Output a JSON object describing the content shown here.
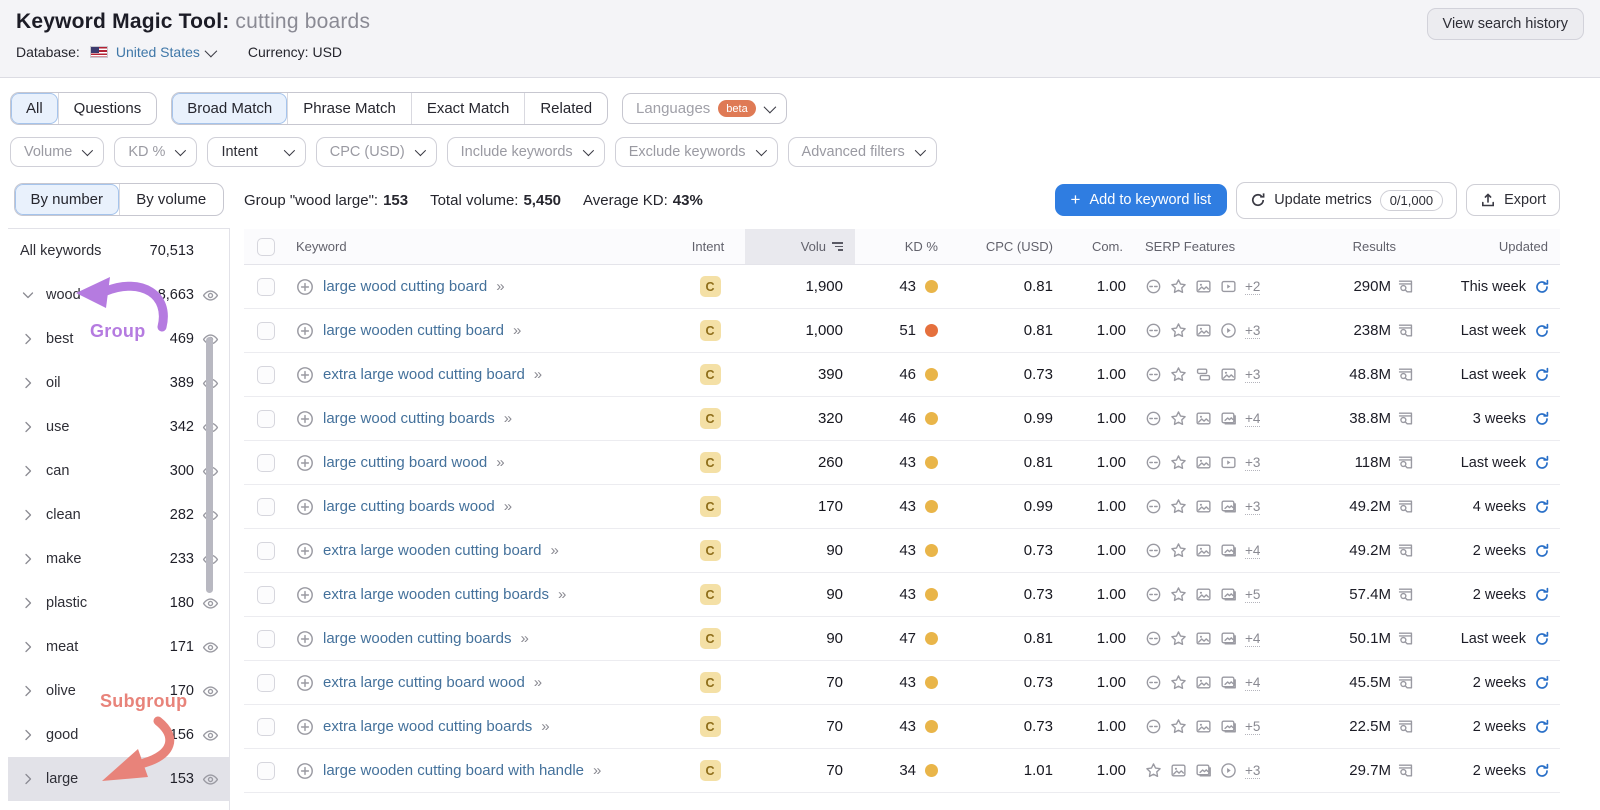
{
  "header": {
    "title": "Keyword Magic Tool:",
    "query": "cutting boards",
    "view_search_history": "View search history",
    "database_label": "Database:",
    "database_value": "United States",
    "currency_label": "Currency:",
    "currency_value": "USD"
  },
  "match_tabs": {
    "group1": [
      {
        "label": "All",
        "active": true
      },
      {
        "label": "Questions",
        "active": false
      }
    ],
    "group2": [
      {
        "label": "Broad Match",
        "active": true
      },
      {
        "label": "Phrase Match",
        "active": false
      },
      {
        "label": "Exact Match",
        "active": false
      },
      {
        "label": "Related",
        "active": false
      }
    ],
    "languages": {
      "label": "Languages",
      "badge": "beta"
    }
  },
  "filters": [
    {
      "label": "Volume",
      "dark": false,
      "wide": false
    },
    {
      "label": "KD %",
      "dark": false,
      "wide": false
    },
    {
      "label": "Intent",
      "dark": true,
      "wide": true
    },
    {
      "label": "CPC (USD)",
      "dark": false,
      "wide": false
    },
    {
      "label": "Include keywords",
      "dark": false,
      "wide": false
    },
    {
      "label": "Exclude keywords",
      "dark": false,
      "wide": false
    },
    {
      "label": "Advanced filters",
      "dark": false,
      "wide": false
    }
  ],
  "sidebar": {
    "tabs": [
      {
        "label": "By number",
        "active": true
      },
      {
        "label": "By volume",
        "active": false
      }
    ],
    "all_keywords": {
      "label": "All keywords",
      "count": "70,513"
    },
    "groups": [
      {
        "label": "wood",
        "count": "8,663",
        "expanded": true,
        "selected": false
      },
      {
        "label": "best",
        "count": "469",
        "expanded": false,
        "selected": false
      },
      {
        "label": "oil",
        "count": "389",
        "expanded": false,
        "selected": false
      },
      {
        "label": "use",
        "count": "342",
        "expanded": false,
        "selected": false
      },
      {
        "label": "can",
        "count": "300",
        "expanded": false,
        "selected": false
      },
      {
        "label": "clean",
        "count": "282",
        "expanded": false,
        "selected": false
      },
      {
        "label": "make",
        "count": "233",
        "expanded": false,
        "selected": false
      },
      {
        "label": "plastic",
        "count": "180",
        "expanded": false,
        "selected": false
      },
      {
        "label": "meat",
        "count": "171",
        "expanded": false,
        "selected": false
      },
      {
        "label": "olive",
        "count": "170",
        "expanded": false,
        "selected": false
      },
      {
        "label": "good",
        "count": "156",
        "expanded": false,
        "selected": false
      },
      {
        "label": "large",
        "count": "153",
        "expanded": false,
        "selected": true
      }
    ],
    "annotations": {
      "group": {
        "text": "Group",
        "color": "#b57be0"
      },
      "subgroup": {
        "text": "Subgroup",
        "color": "#e8837a"
      }
    }
  },
  "toolbar": {
    "group_label": "Group \"wood large\":",
    "group_count": "153",
    "total_volume_label": "Total volume:",
    "total_volume": "5,450",
    "avg_kd_label": "Average KD:",
    "avg_kd": "43%",
    "add_button": "Add to keyword list",
    "update_button": "Update metrics",
    "update_badge": "0/1,000",
    "export_button": "Export"
  },
  "table": {
    "columns": {
      "keyword": "Keyword",
      "intent": "Intent",
      "volume": "Volu",
      "kd": "KD %",
      "cpc": "CPC (USD)",
      "com": "Com.",
      "serp": "SERP Features",
      "results": "Results",
      "updated": "Updated"
    },
    "intent_colors": {
      "bg": "#f4e0a6",
      "text": "#8f6e1a"
    },
    "kd_colors": {
      "yellow": "#e9b549",
      "orange": "#e5703d"
    },
    "rows": [
      {
        "keyword": "large wood cutting board",
        "intent": "C",
        "volume": "1,900",
        "kd": "43",
        "kd_color": "yellow",
        "cpc": "0.81",
        "com": "1.00",
        "serp_icons": [
          "link",
          "star",
          "image",
          "video"
        ],
        "serp_more": "+2",
        "results": "290M",
        "updated": "This week"
      },
      {
        "keyword": "large wooden cutting board",
        "intent": "C",
        "volume": "1,000",
        "kd": "51",
        "kd_color": "orange",
        "cpc": "0.81",
        "com": "1.00",
        "serp_icons": [
          "link",
          "star",
          "image",
          "play"
        ],
        "serp_more": "+3",
        "results": "238M",
        "updated": "Last week"
      },
      {
        "keyword": "extra large wood cutting board",
        "intent": "C",
        "volume": "390",
        "kd": "46",
        "kd_color": "yellow",
        "cpc": "0.73",
        "com": "1.00",
        "serp_icons": [
          "link",
          "star",
          "sitelinks",
          "image"
        ],
        "serp_more": "+3",
        "results": "48.8M",
        "updated": "Last week"
      },
      {
        "keyword": "large wood cutting boards",
        "intent": "C",
        "volume": "320",
        "kd": "46",
        "kd_color": "yellow",
        "cpc": "0.99",
        "com": "1.00",
        "serp_icons": [
          "link",
          "star",
          "image",
          "images"
        ],
        "serp_more": "+4",
        "results": "38.8M",
        "updated": "3 weeks"
      },
      {
        "keyword": "large cutting board wood",
        "intent": "C",
        "volume": "260",
        "kd": "43",
        "kd_color": "yellow",
        "cpc": "0.81",
        "com": "1.00",
        "serp_icons": [
          "link",
          "star",
          "image",
          "video"
        ],
        "serp_more": "+3",
        "results": "118M",
        "updated": "Last week"
      },
      {
        "keyword": "large cutting boards wood",
        "intent": "C",
        "volume": "170",
        "kd": "43",
        "kd_color": "yellow",
        "cpc": "0.99",
        "com": "1.00",
        "serp_icons": [
          "link",
          "star",
          "image",
          "images"
        ],
        "serp_more": "+3",
        "results": "49.2M",
        "updated": "4 weeks"
      },
      {
        "keyword": "extra large wooden cutting board",
        "intent": "C",
        "volume": "90",
        "kd": "43",
        "kd_color": "yellow",
        "cpc": "0.73",
        "com": "1.00",
        "serp_icons": [
          "link",
          "star",
          "image",
          "images"
        ],
        "serp_more": "+4",
        "results": "49.2M",
        "updated": "2 weeks"
      },
      {
        "keyword": "extra large wooden cutting boards",
        "intent": "C",
        "volume": "90",
        "kd": "43",
        "kd_color": "yellow",
        "cpc": "0.73",
        "com": "1.00",
        "serp_icons": [
          "link",
          "star",
          "image",
          "images"
        ],
        "serp_more": "+5",
        "results": "57.4M",
        "updated": "2 weeks"
      },
      {
        "keyword": "large wooden cutting boards",
        "intent": "C",
        "volume": "90",
        "kd": "47",
        "kd_color": "yellow",
        "cpc": "0.81",
        "com": "1.00",
        "serp_icons": [
          "link",
          "star",
          "image",
          "images"
        ],
        "serp_more": "+4",
        "results": "50.1M",
        "updated": "Last week"
      },
      {
        "keyword": "extra large cutting board wood",
        "intent": "C",
        "volume": "70",
        "kd": "43",
        "kd_color": "yellow",
        "cpc": "0.73",
        "com": "1.00",
        "serp_icons": [
          "link",
          "star",
          "image",
          "images"
        ],
        "serp_more": "+4",
        "results": "45.5M",
        "updated": "2 weeks"
      },
      {
        "keyword": "extra large wood cutting boards",
        "intent": "C",
        "volume": "70",
        "kd": "43",
        "kd_color": "yellow",
        "cpc": "0.73",
        "com": "1.00",
        "serp_icons": [
          "link",
          "star",
          "image",
          "images"
        ],
        "serp_more": "+5",
        "results": "22.5M",
        "updated": "2 weeks"
      },
      {
        "keyword": "large wooden cutting board with handle",
        "intent": "C",
        "volume": "70",
        "kd": "34",
        "kd_color": "yellow",
        "cpc": "1.01",
        "com": "1.00",
        "serp_icons": [
          "star",
          "image",
          "images",
          "play"
        ],
        "serp_more": "+3",
        "results": "29.7M",
        "updated": "2 weeks"
      }
    ]
  }
}
